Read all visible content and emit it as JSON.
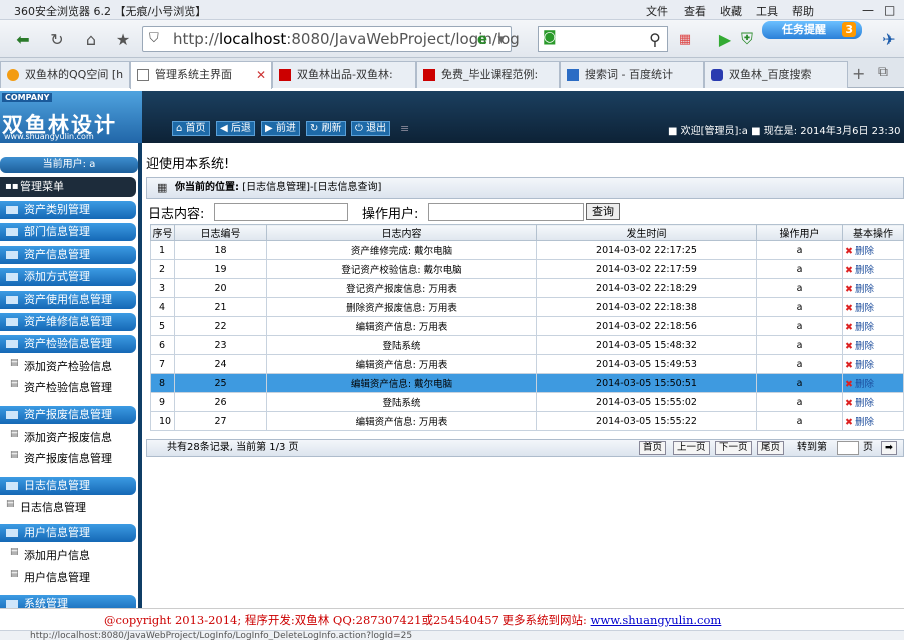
{
  "browser": {
    "title": "360安全浏览器 6.2 【无痕/小号浏览】",
    "menu": [
      "文件",
      "查看",
      "收藏",
      "工具",
      "帮助"
    ],
    "address_host": "localhost",
    "address_rest": ":8080/JavaWebProject/login/log",
    "address_scheme": "http://",
    "task_reminder": "任务提醒",
    "task_count": "3",
    "tabs": [
      {
        "label": "双鱼林的QQ空间 [h",
        "active": false
      },
      {
        "label": "管理系统主界面",
        "active": true
      },
      {
        "label": "双鱼林出品-双鱼林:",
        "active": false
      },
      {
        "label": "免费_毕业课程范例:",
        "active": false
      },
      {
        "label": "搜索词 - 百度统计",
        "active": false
      },
      {
        "label": "双鱼林_百度搜索",
        "active": false
      }
    ],
    "status_url": "http://localhost:8080/JavaWebProject/LogInfo/LogInfo_DeleteLogInfo.action?logId=25"
  },
  "header": {
    "company": "COMPANY",
    "logo_name": "双鱼林设计",
    "logo_url": "www.shuangyulin.com",
    "buttons": [
      "首页",
      "后退",
      "前进",
      "刷新",
      "退出"
    ],
    "welcome": "■ 欢迎[管理员]:a ■ 现在是: 2014年3月6日 23:30"
  },
  "sidebar": {
    "current_user": "当前用户: a",
    "main_menu": "管理菜单",
    "groups": [
      {
        "label": "资产类别管理",
        "items": []
      },
      {
        "label": "部门信息管理",
        "items": []
      },
      {
        "label": "资产信息管理",
        "items": []
      },
      {
        "label": "添加方式管理",
        "items": []
      },
      {
        "label": "资产使用信息管理",
        "items": []
      },
      {
        "label": "资产维修信息管理",
        "items": []
      },
      {
        "label": "资产检验信息管理",
        "items": [
          "添加资产检验信息",
          "资产检验信息管理"
        ]
      },
      {
        "label": "资产报废信息管理",
        "items": [
          "添加资产报废信息",
          "资产报废信息管理"
        ]
      },
      {
        "label": "日志信息管理",
        "items": [
          "日志信息管理"
        ]
      },
      {
        "label": "用户信息管理",
        "items": [
          "添加用户信息",
          "用户信息管理"
        ]
      },
      {
        "label": "系统管理",
        "items": []
      }
    ]
  },
  "content": {
    "banner": "迎使用本系统!",
    "breadcrumb_label": "你当前的位置:",
    "breadcrumb_path": "[日志信息管理]-[日志信息查询]",
    "filter_content_label": "日志内容:",
    "filter_user_label": "操作用户:",
    "filter_content_value": "",
    "filter_user_value": "",
    "query_button": "查询",
    "columns": [
      "序号",
      "日志编号",
      "日志内容",
      "发生时间",
      "操作用户",
      "基本操作"
    ],
    "rows": [
      [
        "1",
        "18",
        "资产维修完成: 戴尔电脑",
        "2014-03-02 22:17:25",
        "a",
        "删除"
      ],
      [
        "2",
        "19",
        "登记资产校验信息: 戴尔电脑",
        "2014-03-02 22:17:59",
        "a",
        "删除"
      ],
      [
        "3",
        "20",
        "登记资产报废信息: 万用表",
        "2014-03-02 22:18:29",
        "a",
        "删除"
      ],
      [
        "4",
        "21",
        "删除资产报废信息: 万用表",
        "2014-03-02 22:18:38",
        "a",
        "删除"
      ],
      [
        "5",
        "22",
        "编辑资产信息: 万用表",
        "2014-03-02 22:18:56",
        "a",
        "删除"
      ],
      [
        "6",
        "23",
        "登陆系统",
        "2014-03-05 15:48:32",
        "a",
        "删除"
      ],
      [
        "7",
        "24",
        "编辑资产信息: 万用表",
        "2014-03-05 15:49:53",
        "a",
        "删除"
      ],
      [
        "8",
        "25",
        "编辑资产信息: 戴尔电脑",
        "2014-03-05 15:50:51",
        "a",
        "删除"
      ],
      [
        "9",
        "26",
        "登陆系统",
        "2014-03-05 15:55:02",
        "a",
        "删除"
      ],
      [
        "10",
        "27",
        "编辑资产信息: 万用表",
        "2014-03-05 15:55:22",
        "a",
        "删除"
      ]
    ],
    "selected_row": 7,
    "pager_summary": "共有28条记录, 当前第 1/3 页",
    "pager_buttons": [
      "首页",
      "上一页",
      "下一页",
      "尾页"
    ],
    "goto_label": "转到第",
    "goto_suffix": "页"
  },
  "footer": {
    "text": "@copyright 2013-2014; 程序开发:双鱼林  QQ:287307421或254540457  更多系统到网站: ",
    "link": "www.shuangyulin.com"
  }
}
